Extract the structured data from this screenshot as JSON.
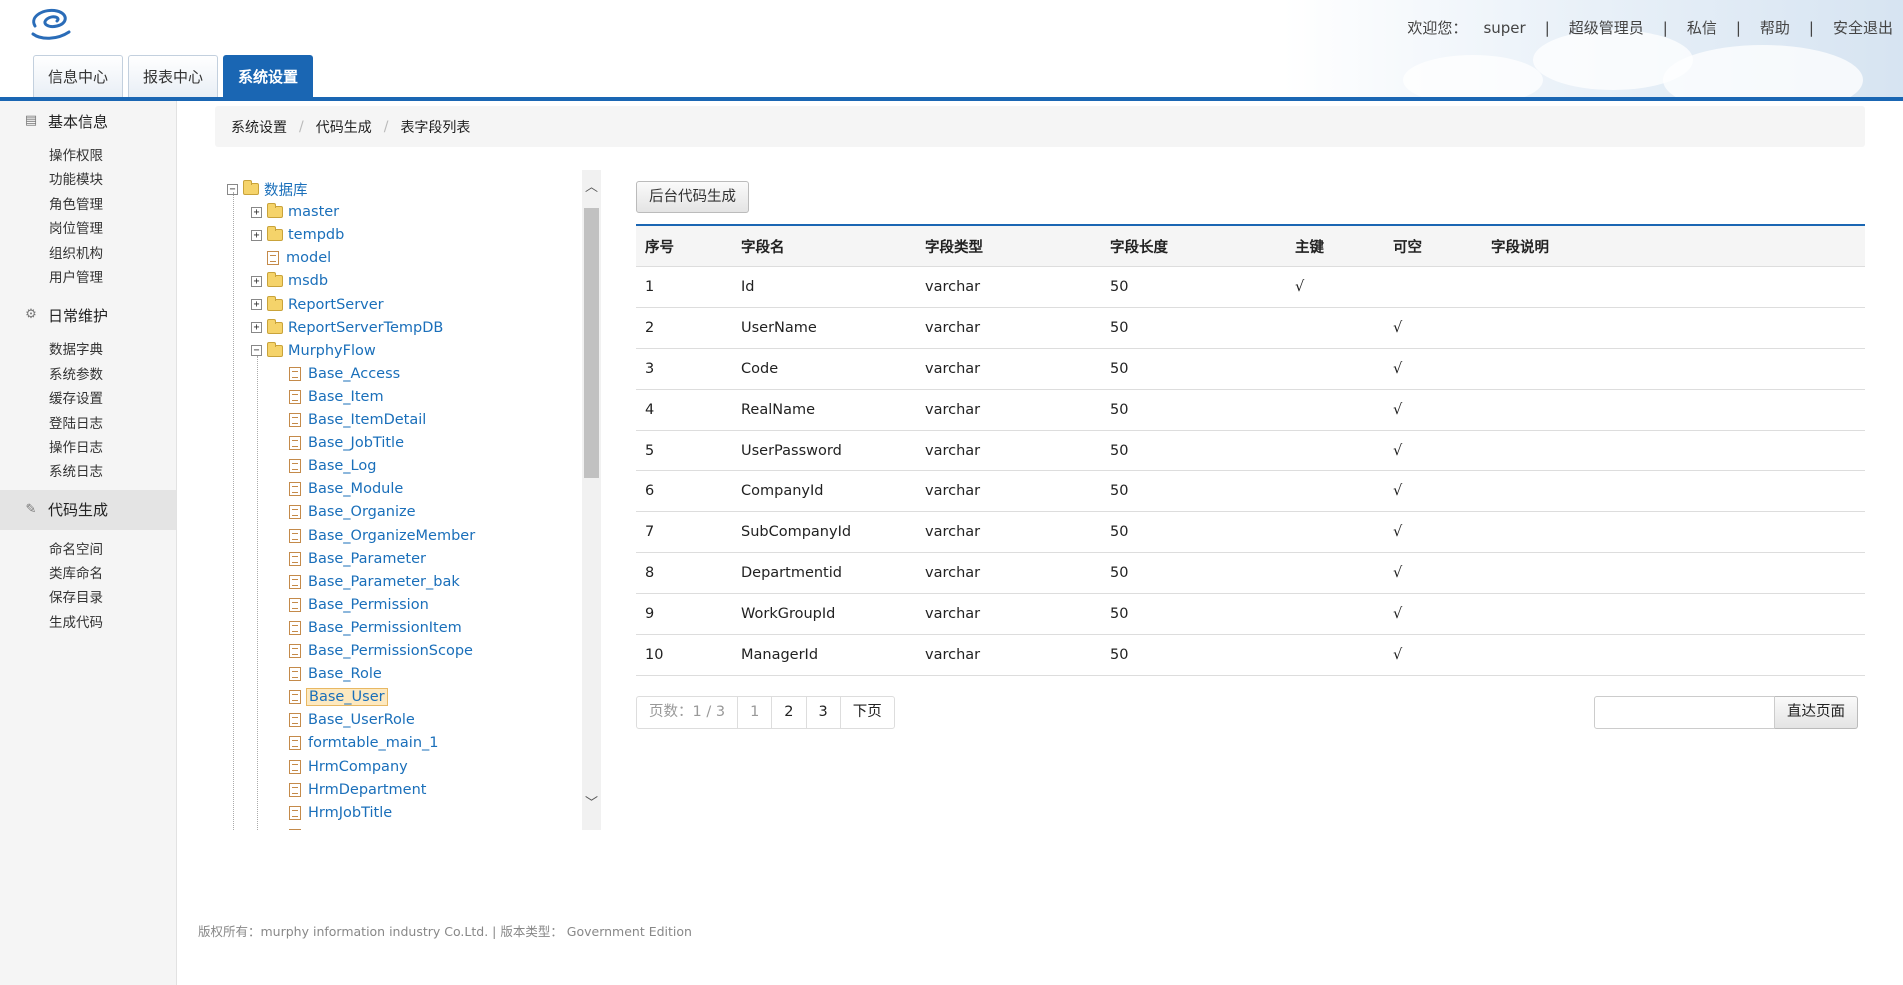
{
  "header": {
    "welcome_label": "欢迎您：",
    "username": "super",
    "role": "超级管理员",
    "message_link": "私信",
    "help_link": "帮助",
    "logout_link": "安全退出",
    "nav_tabs": [
      {
        "label": "信息中心",
        "active": false
      },
      {
        "label": "报表中心",
        "active": false
      },
      {
        "label": "系统设置",
        "active": true
      }
    ],
    "accent_color": "#1a66b3"
  },
  "sidebar": {
    "groups": [
      {
        "title": "基本信息",
        "icon": "list-icon",
        "items": [
          "操作权限",
          "功能模块",
          "角色管理",
          "岗位管理",
          "组织机构",
          "用户管理"
        ]
      },
      {
        "title": "日常维护",
        "icon": "gear-icon",
        "items": [
          "数据字典",
          "系统参数",
          "缓存设置",
          "登陆日志",
          "操作日志",
          "系统日志"
        ]
      },
      {
        "title": "代码生成",
        "icon": "pencil-icon",
        "active": true,
        "items": [
          "命名空间",
          "类库命名",
          "保存目录",
          "生成代码"
        ]
      }
    ]
  },
  "breadcrumb": [
    "系统设置",
    "代码生成",
    "表字段列表"
  ],
  "tree": {
    "root": "数据库",
    "databases": [
      {
        "name": "master",
        "type": "folder",
        "state": "collapsed"
      },
      {
        "name": "tempdb",
        "type": "folder",
        "state": "collapsed"
      },
      {
        "name": "model",
        "type": "doc"
      },
      {
        "name": "msdb",
        "type": "folder",
        "state": "collapsed"
      },
      {
        "name": "ReportServer",
        "type": "folder",
        "state": "collapsed"
      },
      {
        "name": "ReportServerTempDB",
        "type": "folder",
        "state": "collapsed"
      },
      {
        "name": "MurphyFlow",
        "type": "folder",
        "state": "expanded"
      }
    ],
    "tables": [
      "Base_Access",
      "Base_Item",
      "Base_ItemDetail",
      "Base_JobTitle",
      "Base_Log",
      "Base_Module",
      "Base_Organize",
      "Base_OrganizeMember",
      "Base_Parameter",
      "Base_Parameter_bak",
      "Base_Permission",
      "Base_PermissionItem",
      "Base_PermissionScope",
      "Base_Role",
      "Base_User",
      "Base_UserRole",
      "formtable_main_1",
      "HrmCompany",
      "HrmDepartment",
      "HrmJobTitle"
    ],
    "selected": "Base_User"
  },
  "toolbar": {
    "generate_button": "后台代码生成"
  },
  "grid": {
    "columns": [
      "序号",
      "字段名",
      "字段类型",
      "字段长度",
      "主键",
      "可空",
      "字段说明"
    ],
    "rows": [
      [
        "1",
        "Id",
        "varchar",
        "50",
        "√",
        "",
        ""
      ],
      [
        "2",
        "UserName",
        "varchar",
        "50",
        "",
        "√",
        ""
      ],
      [
        "3",
        "Code",
        "varchar",
        "50",
        "",
        "√",
        ""
      ],
      [
        "4",
        "RealName",
        "varchar",
        "50",
        "",
        "√",
        ""
      ],
      [
        "5",
        "UserPassword",
        "varchar",
        "50",
        "",
        "√",
        ""
      ],
      [
        "6",
        "CompanyId",
        "varchar",
        "50",
        "",
        "√",
        ""
      ],
      [
        "7",
        "SubCompanyId",
        "varchar",
        "50",
        "",
        "√",
        ""
      ],
      [
        "8",
        "Departmentid",
        "varchar",
        "50",
        "",
        "√",
        ""
      ],
      [
        "9",
        "WorkGroupId",
        "varchar",
        "50",
        "",
        "√",
        ""
      ],
      [
        "10",
        "ManagerId",
        "varchar",
        "50",
        "",
        "√",
        ""
      ]
    ]
  },
  "pager": {
    "info": "页数：1 / 3",
    "pages": [
      "1",
      "2",
      "3"
    ],
    "next": "下页",
    "goto_button": "直达页面",
    "goto_value": ""
  },
  "footer": "版权所有：murphy information industry Co.Ltd. | 版本类型： Government Edition"
}
